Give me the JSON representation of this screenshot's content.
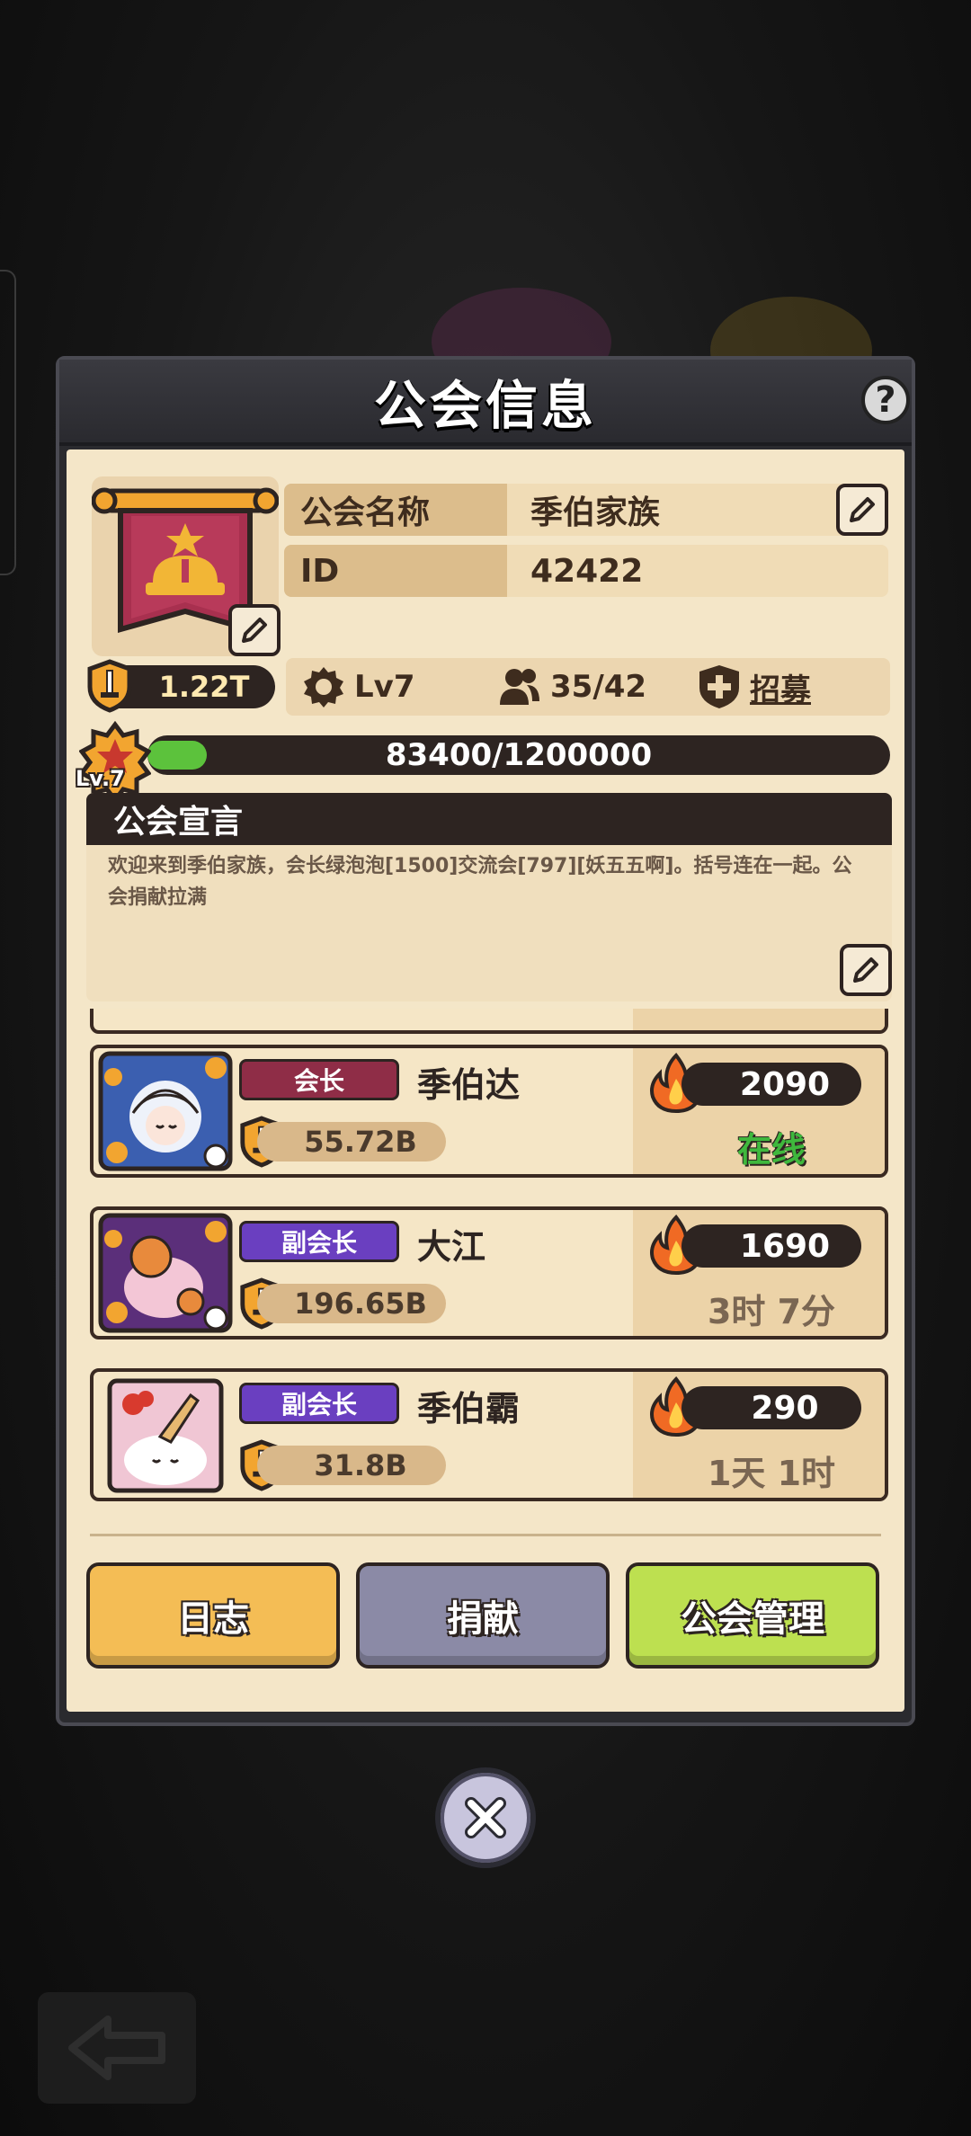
{
  "panel": {
    "title": "公会信息",
    "help_symbol": "?"
  },
  "guild": {
    "name_key": "公会名称",
    "name_value": "季伯家族",
    "id_key": "ID",
    "id_value": "42422",
    "power": "1.22T",
    "level": "Lv7",
    "members": "35/42",
    "recruit_label": "招募",
    "level_badge": "Lv.7",
    "exp_text": "83400/1200000",
    "exp_current": 83400,
    "exp_max": 1200000
  },
  "declaration": {
    "title": "公会宣言",
    "text": "欢迎来到季伯家族，会长绿泡泡[1500]交流会[797][妖五五啊]。括号连在一起。公会捐献拉满"
  },
  "members": [
    {
      "role": "会长",
      "name": "季伯达",
      "power": "55.72B",
      "heat": "2090",
      "status": "在线",
      "online": true,
      "role_color": "#8f2d47"
    },
    {
      "role": "副会长",
      "name": "大江",
      "power": "196.65B",
      "heat": "1690",
      "status": "3时 7分",
      "online": false,
      "role_color": "#6a3fc0"
    },
    {
      "role": "副会长",
      "name": "季伯霸",
      "power": "31.8B",
      "heat": "290",
      "status": "1天 1时",
      "online": false,
      "role_color": "#6a3fc0"
    }
  ],
  "buttons": {
    "log": "日志",
    "donate": "捐献",
    "manage": "公会管理"
  },
  "colors": {
    "log_btn": "#f4bd55",
    "donate_btn": "#8b8aa6",
    "manage_btn": "#bde050",
    "banner": "#a8304f",
    "online_text": "#3fb83d"
  }
}
